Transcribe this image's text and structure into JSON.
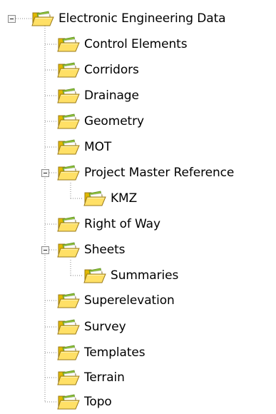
{
  "tree": {
    "root": {
      "label": "Electronic Engineering Data",
      "expanded": true,
      "icon": "folder-icon"
    },
    "items": [
      {
        "label": "Control Elements",
        "icon": "folder-icon"
      },
      {
        "label": "Corridors",
        "icon": "folder-icon"
      },
      {
        "label": "Drainage",
        "icon": "folder-icon"
      },
      {
        "label": "Geometry",
        "icon": "folder-icon"
      },
      {
        "label": "MOT",
        "icon": "folder-icon"
      },
      {
        "label": "Project Master Reference",
        "icon": "folder-icon",
        "expanded": true,
        "children": [
          {
            "label": "KMZ",
            "icon": "folder-icon"
          }
        ]
      },
      {
        "label": "Right of Way",
        "icon": "folder-icon"
      },
      {
        "label": "Sheets",
        "icon": "folder-icon",
        "expanded": true,
        "children": [
          {
            "label": "Summaries",
            "icon": "folder-icon"
          }
        ]
      },
      {
        "label": "Superelevation",
        "icon": "folder-icon"
      },
      {
        "label": "Survey",
        "icon": "folder-icon"
      },
      {
        "label": "Templates",
        "icon": "folder-icon"
      },
      {
        "label": "Terrain",
        "icon": "folder-icon"
      },
      {
        "label": "Topo",
        "icon": "folder-icon"
      }
    ],
    "colors": {
      "folder_front": "#ffe066",
      "folder_back": "#e0b800",
      "folder_outline": "#9a7a1a",
      "folder_green": "#8cbf3a",
      "guide_line": "#8a8a8a"
    }
  }
}
